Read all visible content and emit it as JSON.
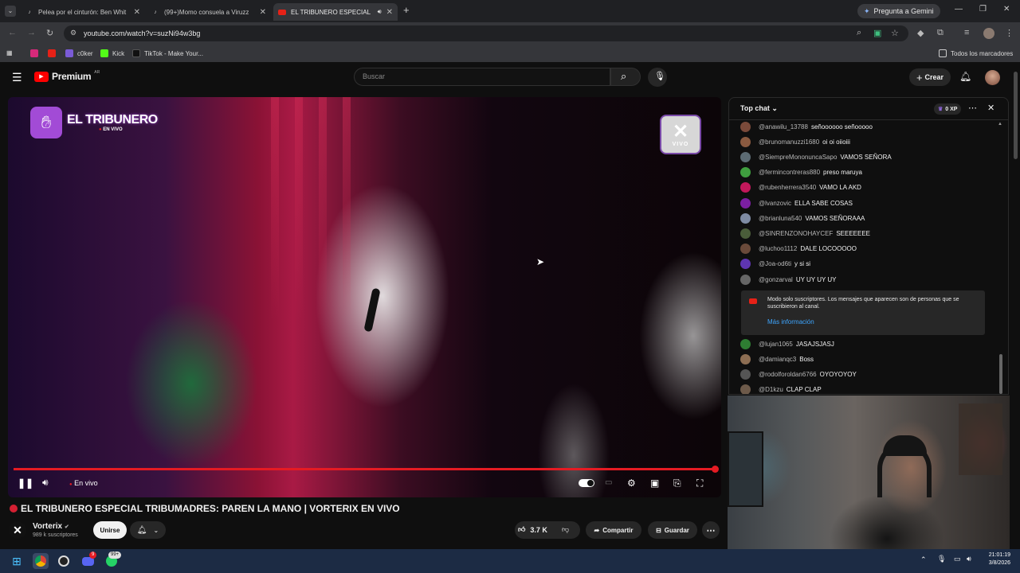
{
  "browser": {
    "tabs": [
      {
        "title": "Pelea por el cinturón: Ben Whit",
        "icon": "tiktok-icon"
      },
      {
        "title": "(99+)Momo consuela a Viruzz",
        "icon": "tiktok-icon"
      },
      {
        "title": "EL TRIBUNERO ESPECIAL",
        "icon": "youtube-icon"
      }
    ],
    "gemini_label": "Pregunta a Gemini",
    "url": "youtube.com/watch?v=suzNi94w3bg",
    "bookmarks": [
      "c0ker",
      "Kick",
      "TikTok - Make Your..."
    ],
    "all_bookmarks_label": "Todos los marcadores"
  },
  "youtube": {
    "logo": "Premium",
    "region": "AR",
    "search_placeholder": "Buscar",
    "create_label": "Crear"
  },
  "video": {
    "overlay_brand": "EL TRIBUNERO",
    "overlay_live": "EN VIVO",
    "corner_logo": "VIVO",
    "live_label": "En vivo",
    "progress": 1.0,
    "title": "EL TRIBUNERO ESPECIAL TRIBUMADRES: PAREN LA MANO | VORTERIX EN VIVO",
    "channel": "Vorterix",
    "subscribers": "989 k suscriptores",
    "join_label": "Unirse",
    "likes": "3.7 K",
    "share_label": "Compartir",
    "save_label": "Guardar"
  },
  "chat": {
    "header": "Top chat",
    "xp": "0 XP",
    "messages_top": [
      {
        "user": "@anawilu_13788",
        "text": "señoooooo señooooo",
        "color": "#7a4a3a"
      },
      {
        "user": "@brunomanuzzi1680",
        "text": "oi oi oiioiii",
        "color": "#8a5a40"
      },
      {
        "user": "@SiempreMononuncaSapo",
        "text": "VAMOS SEÑORA",
        "color": "#5c6b73"
      },
      {
        "user": "@fermincontreras880",
        "text": "preso maruya",
        "color": "#3f9f3f"
      },
      {
        "user": "@rubenherrera3540",
        "text": "VAMO LA AKD",
        "color": "#c2185b"
      },
      {
        "user": "@lvanzovic",
        "text": "ELLA SABE COSAS",
        "color": "#7b1fa2"
      },
      {
        "user": "@brianluna540",
        "text": "VAMOS SEÑORAAA",
        "color": "#7e8ba3"
      },
      {
        "user": "@SINRENZONOHAYCEF",
        "text": "SEEEEEEE",
        "color": "#4a5d3a"
      },
      {
        "user": "@luchoo1112",
        "text": "DALE LOCOOOOO",
        "color": "#6a4a3a"
      },
      {
        "user": "@Joa-od6ti",
        "text": "y si si",
        "color": "#5e35b1"
      },
      {
        "user": "@gonzarval",
        "text": "UY UY UY UY",
        "color": "#666666"
      }
    ],
    "notice_text": "Modo solo suscriptores. Los mensajes que aparecen son de personas que se suscribieron al canal.",
    "notice_link": "Más información",
    "messages_bottom": [
      {
        "user": "@lujan1065",
        "text": "JASAJSJASJ",
        "color": "#2e7d32"
      },
      {
        "user": "@damianqc3",
        "text": "Boss",
        "color": "#8d6e53"
      },
      {
        "user": "@rodolforoldan6766",
        "text": "OYOYOYOY",
        "color": "#555555"
      },
      {
        "user": "@D1kzu",
        "text": "CLAP CLAP",
        "color": "#6d5a4a"
      }
    ]
  },
  "taskbar": {
    "time": "21:01:19",
    "date": "3/8/2026",
    "badge_discord": "9",
    "badge_whatsapp": "99+"
  }
}
